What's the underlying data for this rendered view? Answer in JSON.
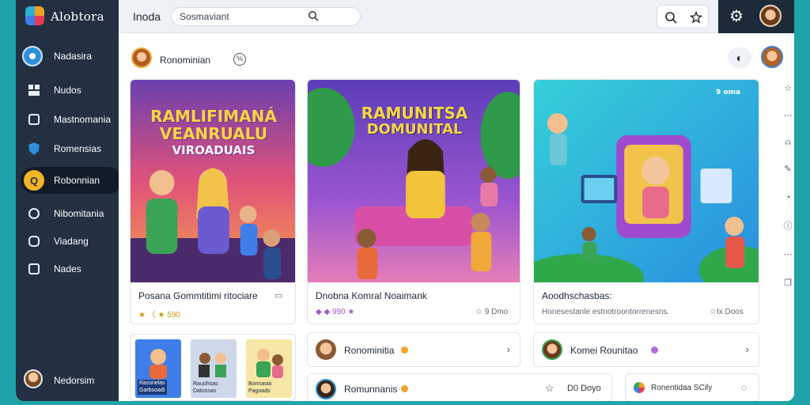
{
  "app": {
    "title": "Alobtora"
  },
  "sidebar": {
    "items": [
      {
        "label": "Nadasira",
        "icon": "navigation-icon"
      },
      {
        "label": "Nudos",
        "icon": "grid-icon"
      },
      {
        "label": "Mastnomania",
        "icon": "folder-icon"
      },
      {
        "label": "Romensias",
        "icon": "shield-icon"
      },
      {
        "label": "Robonnian",
        "icon": "q-badge-icon",
        "active": true
      },
      {
        "label": "Nibomitania",
        "icon": "user-icon"
      },
      {
        "label": "Viadang",
        "icon": "message-icon"
      },
      {
        "label": "Nades",
        "icon": "document-icon"
      }
    ],
    "user": {
      "name": "Nedorsim"
    }
  },
  "topbar": {
    "page_title": "Inoda",
    "search_placeholder": "Sosmaviant",
    "icons": [
      "search-icon",
      "star-icon",
      "gear-icon"
    ]
  },
  "section": {
    "label": "Ronominian"
  },
  "cards": [
    {
      "art_title": [
        "RAMLIFIMANÁ",
        "VEANRUALU",
        "VIROADUAIS"
      ],
      "title": "Posana Gommtitimi ritociare",
      "meta": "★ 〈 ★ 590",
      "right": ""
    },
    {
      "art_title": [
        "RAMUNITSA",
        "DOMUNITAL"
      ],
      "title": "Dnobna Komral Noaimank",
      "meta": "◆ ◆ 990 ★",
      "right": "☆ 9 Dmo"
    },
    {
      "art_title": [
        "9 oma"
      ],
      "title": "Aoodhschasbas:",
      "meta": "Honesestanle estnotroontorrenesns.",
      "right": "☆Ix Doos"
    }
  ],
  "thumbs": [
    {
      "label": [
        "Rassnelas",
        "Garbsoadi"
      ]
    },
    {
      "label": [
        "Rauohsas",
        "Datossas"
      ]
    },
    {
      "label": [
        "Bonnasia",
        "Pagoads"
      ]
    }
  ],
  "list_rows": [
    {
      "label": "Ronominitia",
      "dot_color": "#f2a32c"
    },
    {
      "label": "Komei Rounitao",
      "dot_color": "#b36ad8"
    },
    {
      "label": "Romunnanis",
      "dot_color": "#f2a32c"
    }
  ],
  "bottom_row": {
    "stat": "D0 Doyo"
  },
  "bottom_right": {
    "label": "Ronentidaa SCily"
  },
  "colors": {
    "sidebar": "#223042",
    "accent": "#f2b525",
    "brand_blue": "#2f8fd8"
  }
}
